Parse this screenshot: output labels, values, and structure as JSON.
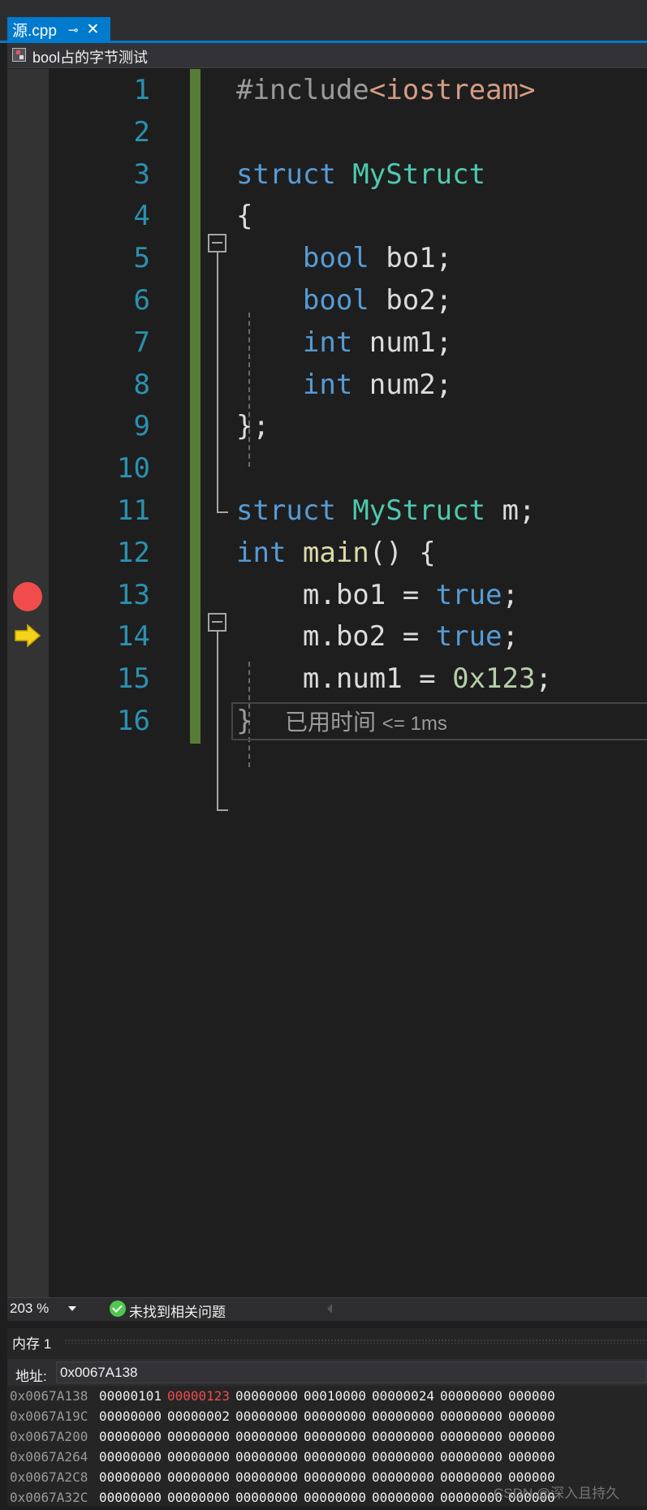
{
  "tab": {
    "title": "源.cpp",
    "pin_glyph": "⊸",
    "close_glyph": "✕"
  },
  "nav": {
    "scope": "bool占的字节测试"
  },
  "editor": {
    "line_numbers": [
      "1",
      "2",
      "3",
      "4",
      "5",
      "6",
      "7",
      "8",
      "9",
      "10",
      "11",
      "12",
      "13",
      "14",
      "15",
      "16"
    ],
    "lines": [
      [
        {
          "t": "#include",
          "c": "pp"
        },
        {
          "t": "<iostream>",
          "c": "str"
        }
      ],
      [],
      [
        {
          "t": "struct ",
          "c": "kw"
        },
        {
          "t": "MyStruct",
          "c": "ty"
        }
      ],
      [
        {
          "t": "{",
          "c": ""
        }
      ],
      [
        {
          "t": "    ",
          "c": ""
        },
        {
          "t": "bool",
          "c": "kw"
        },
        {
          "t": " bo1;",
          "c": ""
        }
      ],
      [
        {
          "t": "    ",
          "c": ""
        },
        {
          "t": "bool",
          "c": "kw"
        },
        {
          "t": " bo2;",
          "c": ""
        }
      ],
      [
        {
          "t": "    ",
          "c": ""
        },
        {
          "t": "int",
          "c": "kw"
        },
        {
          "t": " num1;",
          "c": ""
        }
      ],
      [
        {
          "t": "    ",
          "c": ""
        },
        {
          "t": "int",
          "c": "kw"
        },
        {
          "t": " num2;",
          "c": ""
        }
      ],
      [
        {
          "t": "};",
          "c": ""
        }
      ],
      [],
      [
        {
          "t": "struct ",
          "c": "kw"
        },
        {
          "t": "MyStruct",
          "c": "ty"
        },
        {
          "t": " m;",
          "c": ""
        }
      ],
      [
        {
          "t": "int ",
          "c": "kw"
        },
        {
          "t": "main",
          "c": "fn"
        },
        {
          "t": "() {",
          "c": ""
        }
      ],
      [
        {
          "t": "    m.bo1 = ",
          "c": ""
        },
        {
          "t": "true",
          "c": "kw"
        },
        {
          "t": ";",
          "c": ""
        }
      ],
      [
        {
          "t": "    m.bo2 = ",
          "c": ""
        },
        {
          "t": "true",
          "c": "kw"
        },
        {
          "t": ";",
          "c": ""
        }
      ],
      [
        {
          "t": "    m.num1 = ",
          "c": ""
        },
        {
          "t": "0x123",
          "c": "num"
        },
        {
          "t": ";",
          "c": ""
        }
      ],
      [
        {
          "t": "}",
          "c": "gray"
        }
      ]
    ],
    "perf_tip": "已用时间",
    "perf_value": "<= 1ms"
  },
  "status": {
    "zoom": "203 %",
    "issues": "未找到相关问题"
  },
  "memory": {
    "title": "内存 1",
    "address_label": "地址:",
    "address_value": "0x0067A138",
    "rows": [
      {
        "addr": "0x0067A138",
        "cells": [
          "00000101",
          "00000123",
          "00000000",
          "00010000",
          "00000024",
          "00000000",
          "000000"
        ],
        "changed": [
          1
        ]
      },
      {
        "addr": "0x0067A19C",
        "cells": [
          "00000000",
          "00000002",
          "00000000",
          "00000000",
          "00000000",
          "00000000",
          "000000"
        ],
        "changed": []
      },
      {
        "addr": "0x0067A200",
        "cells": [
          "00000000",
          "00000000",
          "00000000",
          "00000000",
          "00000000",
          "00000000",
          "000000"
        ],
        "changed": []
      },
      {
        "addr": "0x0067A264",
        "cells": [
          "00000000",
          "00000000",
          "00000000",
          "00000000",
          "00000000",
          "00000000",
          "000000"
        ],
        "changed": []
      },
      {
        "addr": "0x0067A2C8",
        "cells": [
          "00000000",
          "00000000",
          "00000000",
          "00000000",
          "00000000",
          "00000000",
          "000000"
        ],
        "changed": []
      },
      {
        "addr": "0x0067A32C",
        "cells": [
          "00000000",
          "00000000",
          "00000000",
          "00000000",
          "00000000",
          "00000000",
          "000000"
        ],
        "changed": []
      }
    ]
  },
  "watermark": "CSDN @深入且持久"
}
